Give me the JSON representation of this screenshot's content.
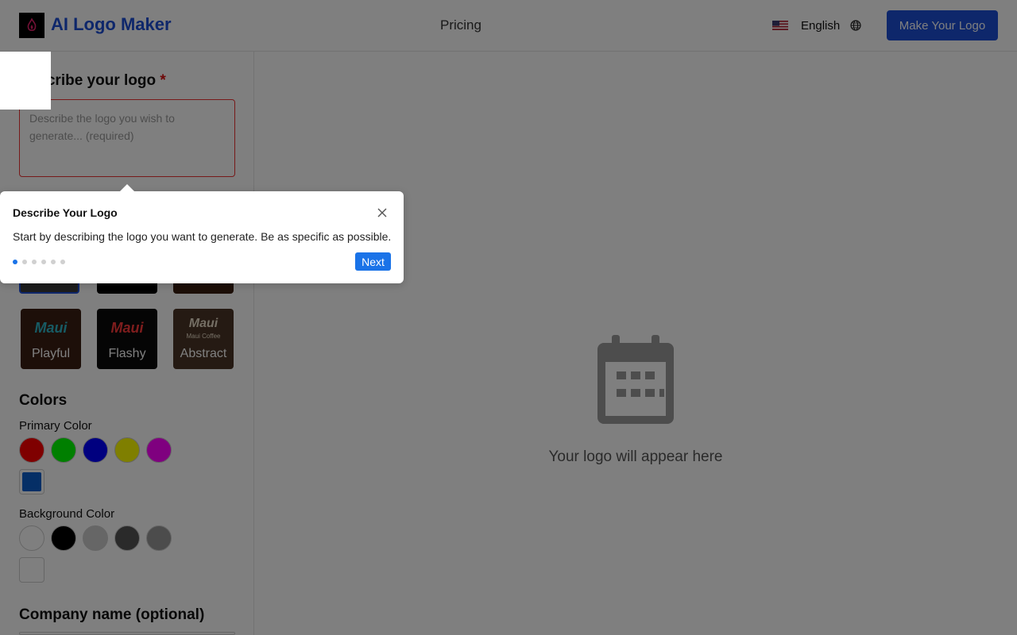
{
  "header": {
    "brand": "AI Logo Maker",
    "nav_pricing": "Pricing",
    "language": "English",
    "cta": "Make Your Logo",
    "brand_color": "#1d4fd7"
  },
  "describe": {
    "title": "Describe your logo",
    "required_mark": "*",
    "placeholder": "Describe the logo you wish to generate... (required)"
  },
  "styles": {
    "tile_text": "Maui",
    "tile_subtext": "Maui Coffee",
    "items": [
      {
        "label": "Playful"
      },
      {
        "label": "Flashy"
      },
      {
        "label": "Abstract"
      }
    ]
  },
  "colors": {
    "title": "Colors",
    "primary_label": "Primary Color",
    "primary_swatches": [
      "#ff0000",
      "#00ff00",
      "#0000ff",
      "#ffff00",
      "#ff00ff"
    ],
    "primary_selected": "#0a5ecc",
    "background_label": "Background Color",
    "background_swatches": [
      "#ffffff",
      "#000000",
      "#cccccc",
      "#555555",
      "#999999"
    ],
    "background_selected": "#ffffff"
  },
  "company": {
    "title": "Company name (optional)"
  },
  "preview": {
    "empty_text": "Your logo will appear here",
    "icon": "calendar-icon"
  },
  "tour": {
    "title": "Describe Your Logo",
    "text": "Start by describing the logo you want to generate. Be as specific as possible.",
    "next": "Next",
    "steps": 6,
    "current_step": 1,
    "accent": "#1a73e8"
  }
}
